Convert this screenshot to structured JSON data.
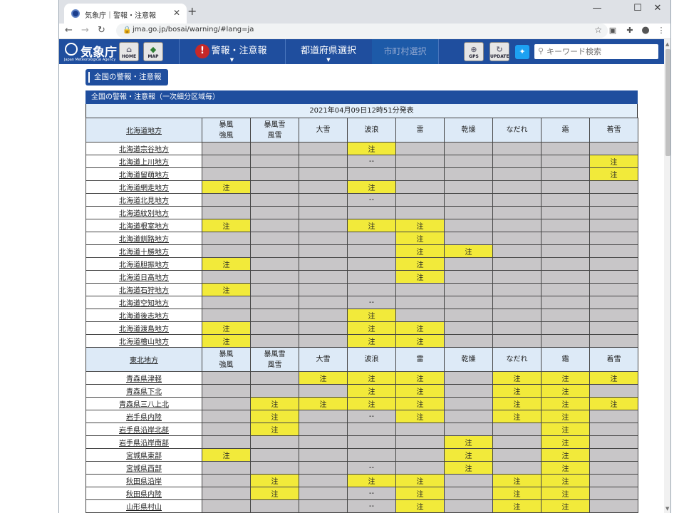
{
  "browser": {
    "tab_title": "気象庁｜警報・注意報",
    "url": "jma.go.jp/bosai/warning/#lang=ja"
  },
  "site": {
    "logo_text": "気象庁",
    "logo_subtext": "Japan Meteorological Agency",
    "home_label": "HOME",
    "map_label": "MAP",
    "menu_warning": "警報・注意報",
    "menu_prefecture": "都道府県選択",
    "menu_municipality": "市町村選択",
    "gps_label": "GPS",
    "update_label": "UPDATE",
    "search_placeholder": "キーワード検索"
  },
  "page": {
    "section_button": "全国の警報・注意報",
    "block_title": "全国の警報・注意報（一次細分区域毎）",
    "issued": "2021年04月09日12時51分発表"
  },
  "colors": {
    "header_blue": "#1f4e9e",
    "advisory_yellow": "#f2ea3a",
    "none_gray": "#c8c6c8"
  },
  "tables": [
    {
      "region": "北海道地方",
      "columns": [
        "暴風\n強風",
        "暴風雪\n風雪",
        "大雪",
        "波浪",
        "雷",
        "乾燥",
        "なだれ",
        "霜",
        "着雪"
      ],
      "rows": [
        {
          "area": "北海道宗谷地方",
          "cells": [
            "",
            "",
            "",
            "注",
            "",
            "",
            "",
            "",
            ""
          ]
        },
        {
          "area": "北海道上川地方",
          "cells": [
            "",
            "",
            "",
            "--",
            "",
            "",
            "",
            "",
            "注"
          ]
        },
        {
          "area": "北海道留萌地方",
          "cells": [
            "",
            "",
            "",
            "",
            "",
            "",
            "",
            "",
            "注"
          ]
        },
        {
          "area": "北海道網走地方",
          "cells": [
            "注",
            "",
            "",
            "注",
            "",
            "",
            "",
            "",
            ""
          ]
        },
        {
          "area": "北海道北見地方",
          "cells": [
            "",
            "",
            "",
            "--",
            "",
            "",
            "",
            "",
            ""
          ]
        },
        {
          "area": "北海道紋別地方",
          "cells": [
            "",
            "",
            "",
            "",
            "",
            "",
            "",
            "",
            ""
          ]
        },
        {
          "area": "北海道根室地方",
          "cells": [
            "注",
            "",
            "",
            "注",
            "注",
            "",
            "",
            "",
            ""
          ]
        },
        {
          "area": "北海道釧路地方",
          "cells": [
            "",
            "",
            "",
            "",
            "注",
            "",
            "",
            "",
            ""
          ]
        },
        {
          "area": "北海道十勝地方",
          "cells": [
            "",
            "",
            "",
            "",
            "注",
            "注",
            "",
            "",
            ""
          ]
        },
        {
          "area": "北海道胆振地方",
          "cells": [
            "注",
            "",
            "",
            "",
            "注",
            "",
            "",
            "",
            ""
          ]
        },
        {
          "area": "北海道日高地方",
          "cells": [
            "",
            "",
            "",
            "",
            "注",
            "",
            "",
            "",
            ""
          ]
        },
        {
          "area": "北海道石狩地方",
          "cells": [
            "注",
            "",
            "",
            "",
            "",
            "",
            "",
            "",
            ""
          ]
        },
        {
          "area": "北海道空知地方",
          "cells": [
            "",
            "",
            "",
            "--",
            "",
            "",
            "",
            "",
            ""
          ]
        },
        {
          "area": "北海道後志地方",
          "cells": [
            "",
            "",
            "",
            "注",
            "",
            "",
            "",
            "",
            ""
          ]
        },
        {
          "area": "北海道渡島地方",
          "cells": [
            "注",
            "",
            "",
            "注",
            "注",
            "",
            "",
            "",
            ""
          ]
        },
        {
          "area": "北海道檜山地方",
          "cells": [
            "注",
            "",
            "",
            "注",
            "注",
            "",
            "",
            "",
            ""
          ]
        }
      ]
    },
    {
      "region": "東北地方",
      "columns": [
        "暴風\n強風",
        "暴風雪\n風雪",
        "大雪",
        "波浪",
        "雷",
        "乾燥",
        "なだれ",
        "霜",
        "着雪"
      ],
      "rows": [
        {
          "area": "青森県津軽",
          "cells": [
            "",
            "",
            "注",
            "注",
            "注",
            "",
            "注",
            "注",
            "注"
          ]
        },
        {
          "area": "青森県下北",
          "cells": [
            "",
            "",
            "",
            "注",
            "注",
            "",
            "注",
            "注",
            ""
          ]
        },
        {
          "area": "青森県三八上北",
          "cells": [
            "",
            "注",
            "注",
            "注",
            "注",
            "",
            "注",
            "注",
            "注"
          ]
        },
        {
          "area": "岩手県内陸",
          "cells": [
            "",
            "注",
            "",
            "--",
            "注",
            "",
            "注",
            "注",
            ""
          ]
        },
        {
          "area": "岩手県沿岸北部",
          "cells": [
            "",
            "注",
            "",
            "",
            "",
            "",
            "",
            "注",
            ""
          ]
        },
        {
          "area": "岩手県沿岸南部",
          "cells": [
            "",
            "",
            "",
            "",
            "",
            "注",
            "",
            "注",
            ""
          ]
        },
        {
          "area": "宮城県東部",
          "cells": [
            "注",
            "",
            "",
            "",
            "",
            "注",
            "",
            "注",
            ""
          ]
        },
        {
          "area": "宮城県西部",
          "cells": [
            "",
            "",
            "",
            "--",
            "",
            "注",
            "",
            "注",
            ""
          ]
        },
        {
          "area": "秋田県沿岸",
          "cells": [
            "",
            "注",
            "",
            "注",
            "注",
            "",
            "注",
            "注",
            ""
          ]
        },
        {
          "area": "秋田県内陸",
          "cells": [
            "",
            "注",
            "",
            "--",
            "注",
            "",
            "注",
            "注",
            ""
          ]
        },
        {
          "area": "山形県村山",
          "cells": [
            "",
            "",
            "",
            "--",
            "注",
            "",
            "注",
            "注",
            ""
          ]
        }
      ]
    }
  ]
}
